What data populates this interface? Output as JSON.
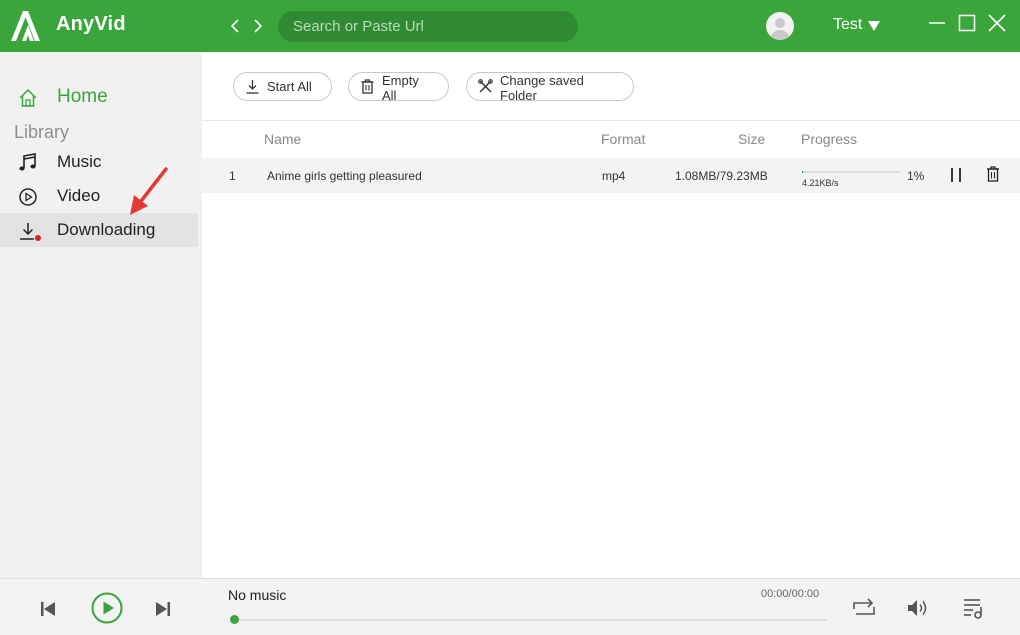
{
  "app": {
    "name": "AnyVid"
  },
  "header": {
    "search_placeholder": "Search or Paste Url",
    "user_name": "Test"
  },
  "sidebar": {
    "home_label": "Home",
    "library_label": "Library",
    "items": [
      {
        "label": "Music",
        "icon": "music-note-icon"
      },
      {
        "label": "Video",
        "icon": "video-play-icon"
      },
      {
        "label": "Downloading",
        "icon": "download-icon",
        "active": true,
        "has_red_dot": true
      }
    ]
  },
  "toolbar": {
    "start_all": "Start All",
    "empty_all": "Empty All",
    "change_folder": "Change saved Folder"
  },
  "table": {
    "columns": [
      "Name",
      "Format",
      "Size",
      "Progress"
    ],
    "rows": [
      {
        "index": "1",
        "name": "Anime girls getting pleasured",
        "format": "mp4",
        "size": "1.08MB/79.23MB",
        "progress_label": "1%",
        "progress": 0.01,
        "speed": "4.21KB/s"
      }
    ]
  },
  "player": {
    "now_playing": "No music",
    "time": "00:00/00:00",
    "seek_position": 0
  },
  "colors": {
    "accent": "#3aa53a",
    "search_bg": "#2f8a33",
    "annotation_arrow": "#e53935"
  }
}
